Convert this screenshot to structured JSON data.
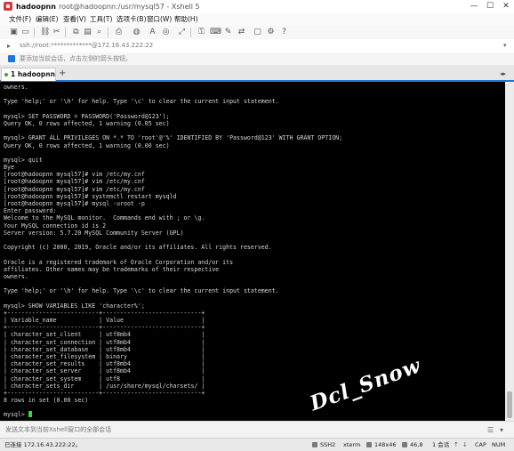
{
  "window": {
    "host": "hadoopnn",
    "title_rest": "root@hadoopnn:/usr/mysql57 - Xshell 5",
    "minimize": "—",
    "maximize": "☐",
    "close": "✕"
  },
  "menu": [
    "文件(F)",
    "编辑(E)",
    "查看(V)",
    "工具(T)",
    "选项卡(B)",
    "窗口(W)",
    "帮助(H)"
  ],
  "address": {
    "text": "ssh://root:*************@172.16.43.222:22"
  },
  "hint": {
    "text": "要添加当前会话，点击左侧的箭头按钮。"
  },
  "tabs": [
    {
      "label": "1 hadoopnn",
      "active": true
    }
  ],
  "terminal": {
    "lines": [
      "owners.",
      "",
      "Type 'help;' or '\\h' for help. Type '\\c' to clear the current input statement.",
      "",
      "mysql> SET PASSWORD = PASSWORD('Password@123');",
      "Query OK, 0 rows affected, 1 warning (0.05 sec)",
      "",
      "mysql> GRANT ALL PRIVILEGES ON *.* TO 'root'@'%' IDENTIFIED BY 'Password@123' WITH GRANT OPTION;",
      "Query OK, 0 rows affected, 1 warning (0.00 sec)",
      "",
      "mysql> quit",
      "Bye",
      "[root@hadoopnn mysql57]# vim /etc/my.cnf",
      "[root@hadoopnn mysql57]# vim /etc/my.cnf",
      "[root@hadoopnn mysql57]# vim /etc/my.cnf",
      "[root@hadoopnn mysql57]# systemctl restart mysqld",
      "[root@hadoopnn mysql57]# mysql -uroot -p",
      "Enter password:",
      "Welcome to the MySQL monitor.  Commands end with ; or \\g.",
      "Your MySQL connection id is 2",
      "Server version: 5.7.20 MySQL Community Server (GPL)",
      "",
      "Copyright (c) 2000, 2019, Oracle and/or its affiliates. All rights reserved.",
      "",
      "Oracle is a registered trademark of Oracle Corporation and/or its",
      "affiliates. Other names may be trademarks of their respective",
      "owners.",
      "",
      "Type 'help;' or '\\h' for help. Type '\\c' to clear the current input statement.",
      "",
      "mysql> SHOW VARIABLES LIKE 'character%';",
      "+--------------------------+----------------------------+",
      "| Variable_name            | Value                      |",
      "+--------------------------+----------------------------+",
      "| character_set_client     | utf8mb4                    |",
      "| character_set_connection | utf8mb4                    |",
      "| character_set_database   | utf8mb4                    |",
      "| character_set_filesystem | binary                     |",
      "| character_set_results    | utf8mb4                    |",
      "| character_set_server     | utf8mb4                    |",
      "| character_set_system     | utf8                       |",
      "| character_sets_dir       | /usr/share/mysql/charsets/ |",
      "+--------------------------+----------------------------+",
      "8 rows in set (0.00 sec)",
      ""
    ],
    "prompt": "mysql> ",
    "watermark": "Dcl_Snow"
  },
  "compose": {
    "placeholder": "发送文本到当前Xshell窗口的全部会话"
  },
  "status": {
    "connected": "已连接 172.16.43.222:22。",
    "protocol": "SSH2",
    "terminal": "xterm",
    "size": "148x46",
    "position": "46,8",
    "sessions": "1 会话",
    "caps": "CAP",
    "num": "NUM"
  },
  "colors": {
    "accent": "#1e76d9",
    "terminal_bg": "#000000",
    "terminal_fg": "#d4d4d4",
    "cursor": "#2fdc3a",
    "app_icon": "#d9363e"
  },
  "icons": [
    "app-icon",
    "new-session-icon",
    "open-folder-icon",
    "link-icon",
    "disconnect-icon",
    "copy-icon",
    "paste-icon",
    "find-icon",
    "print-icon",
    "color-icon",
    "font-icon",
    "globe-icon",
    "fullscreen-icon",
    "lock-icon",
    "keyboard-icon",
    "compose-icon",
    "help-icon",
    "arrow-icon",
    "close-icon",
    "plus-icon"
  ]
}
